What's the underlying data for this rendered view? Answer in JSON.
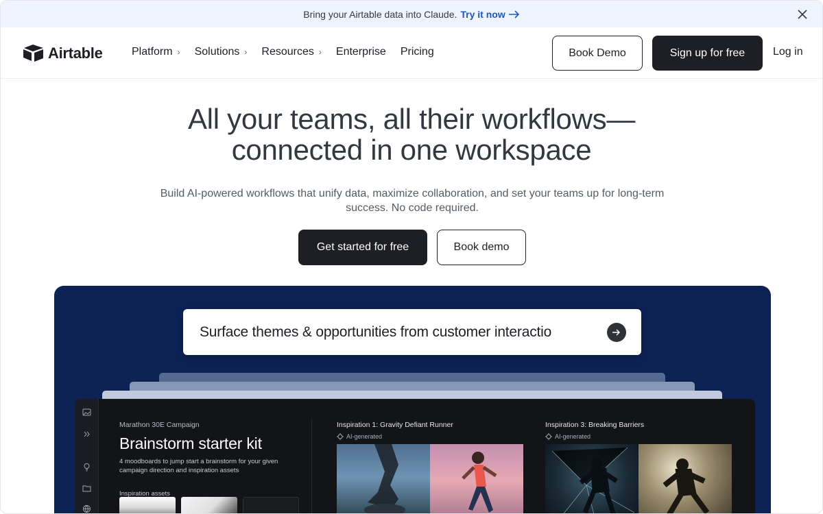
{
  "banner": {
    "text": "Bring your Airtable data into Claude.",
    "cta": "Try it now"
  },
  "nav": {
    "logo_text": "Airtable",
    "links": [
      {
        "label": "Platform"
      },
      {
        "label": "Solutions"
      },
      {
        "label": "Resources"
      },
      {
        "label": "Enterprise"
      },
      {
        "label": "Pricing"
      }
    ],
    "book_demo": "Book Demo",
    "signup": "Sign up for free",
    "login": "Log in"
  },
  "hero": {
    "title_line1": "All your teams, all their workflows—",
    "title_line2": "connected in one workspace",
    "subtitle": "Build AI-powered workflows that unify data, maximize collaboration, and set your teams up for long-term success. No code required.",
    "primary_cta": "Get started for free",
    "secondary_cta": "Book demo"
  },
  "showcase": {
    "prompt": "Surface themes & opportunities from customer interactio",
    "app": {
      "eyebrow": "Marathon 30E Campaign",
      "title": "Brainstorm starter kit",
      "description": "4 moodboards to jump start a brainstorm for your given campaign direction and inspiration assets",
      "assets_label": "Inspiration assets",
      "inspirations": [
        {
          "title": "Inspiration 1: Gravity Defiant Runner",
          "badge": "AI-generated"
        },
        {
          "title": "Inspiration 3: Breaking Barriers",
          "badge": "AI-generated"
        }
      ]
    }
  },
  "colors": {
    "dark_button": "#1d1f25",
    "banner_bg": "#eef3fd",
    "banner_link": "#1b57c6",
    "showcase_bg": "#0d2255"
  }
}
